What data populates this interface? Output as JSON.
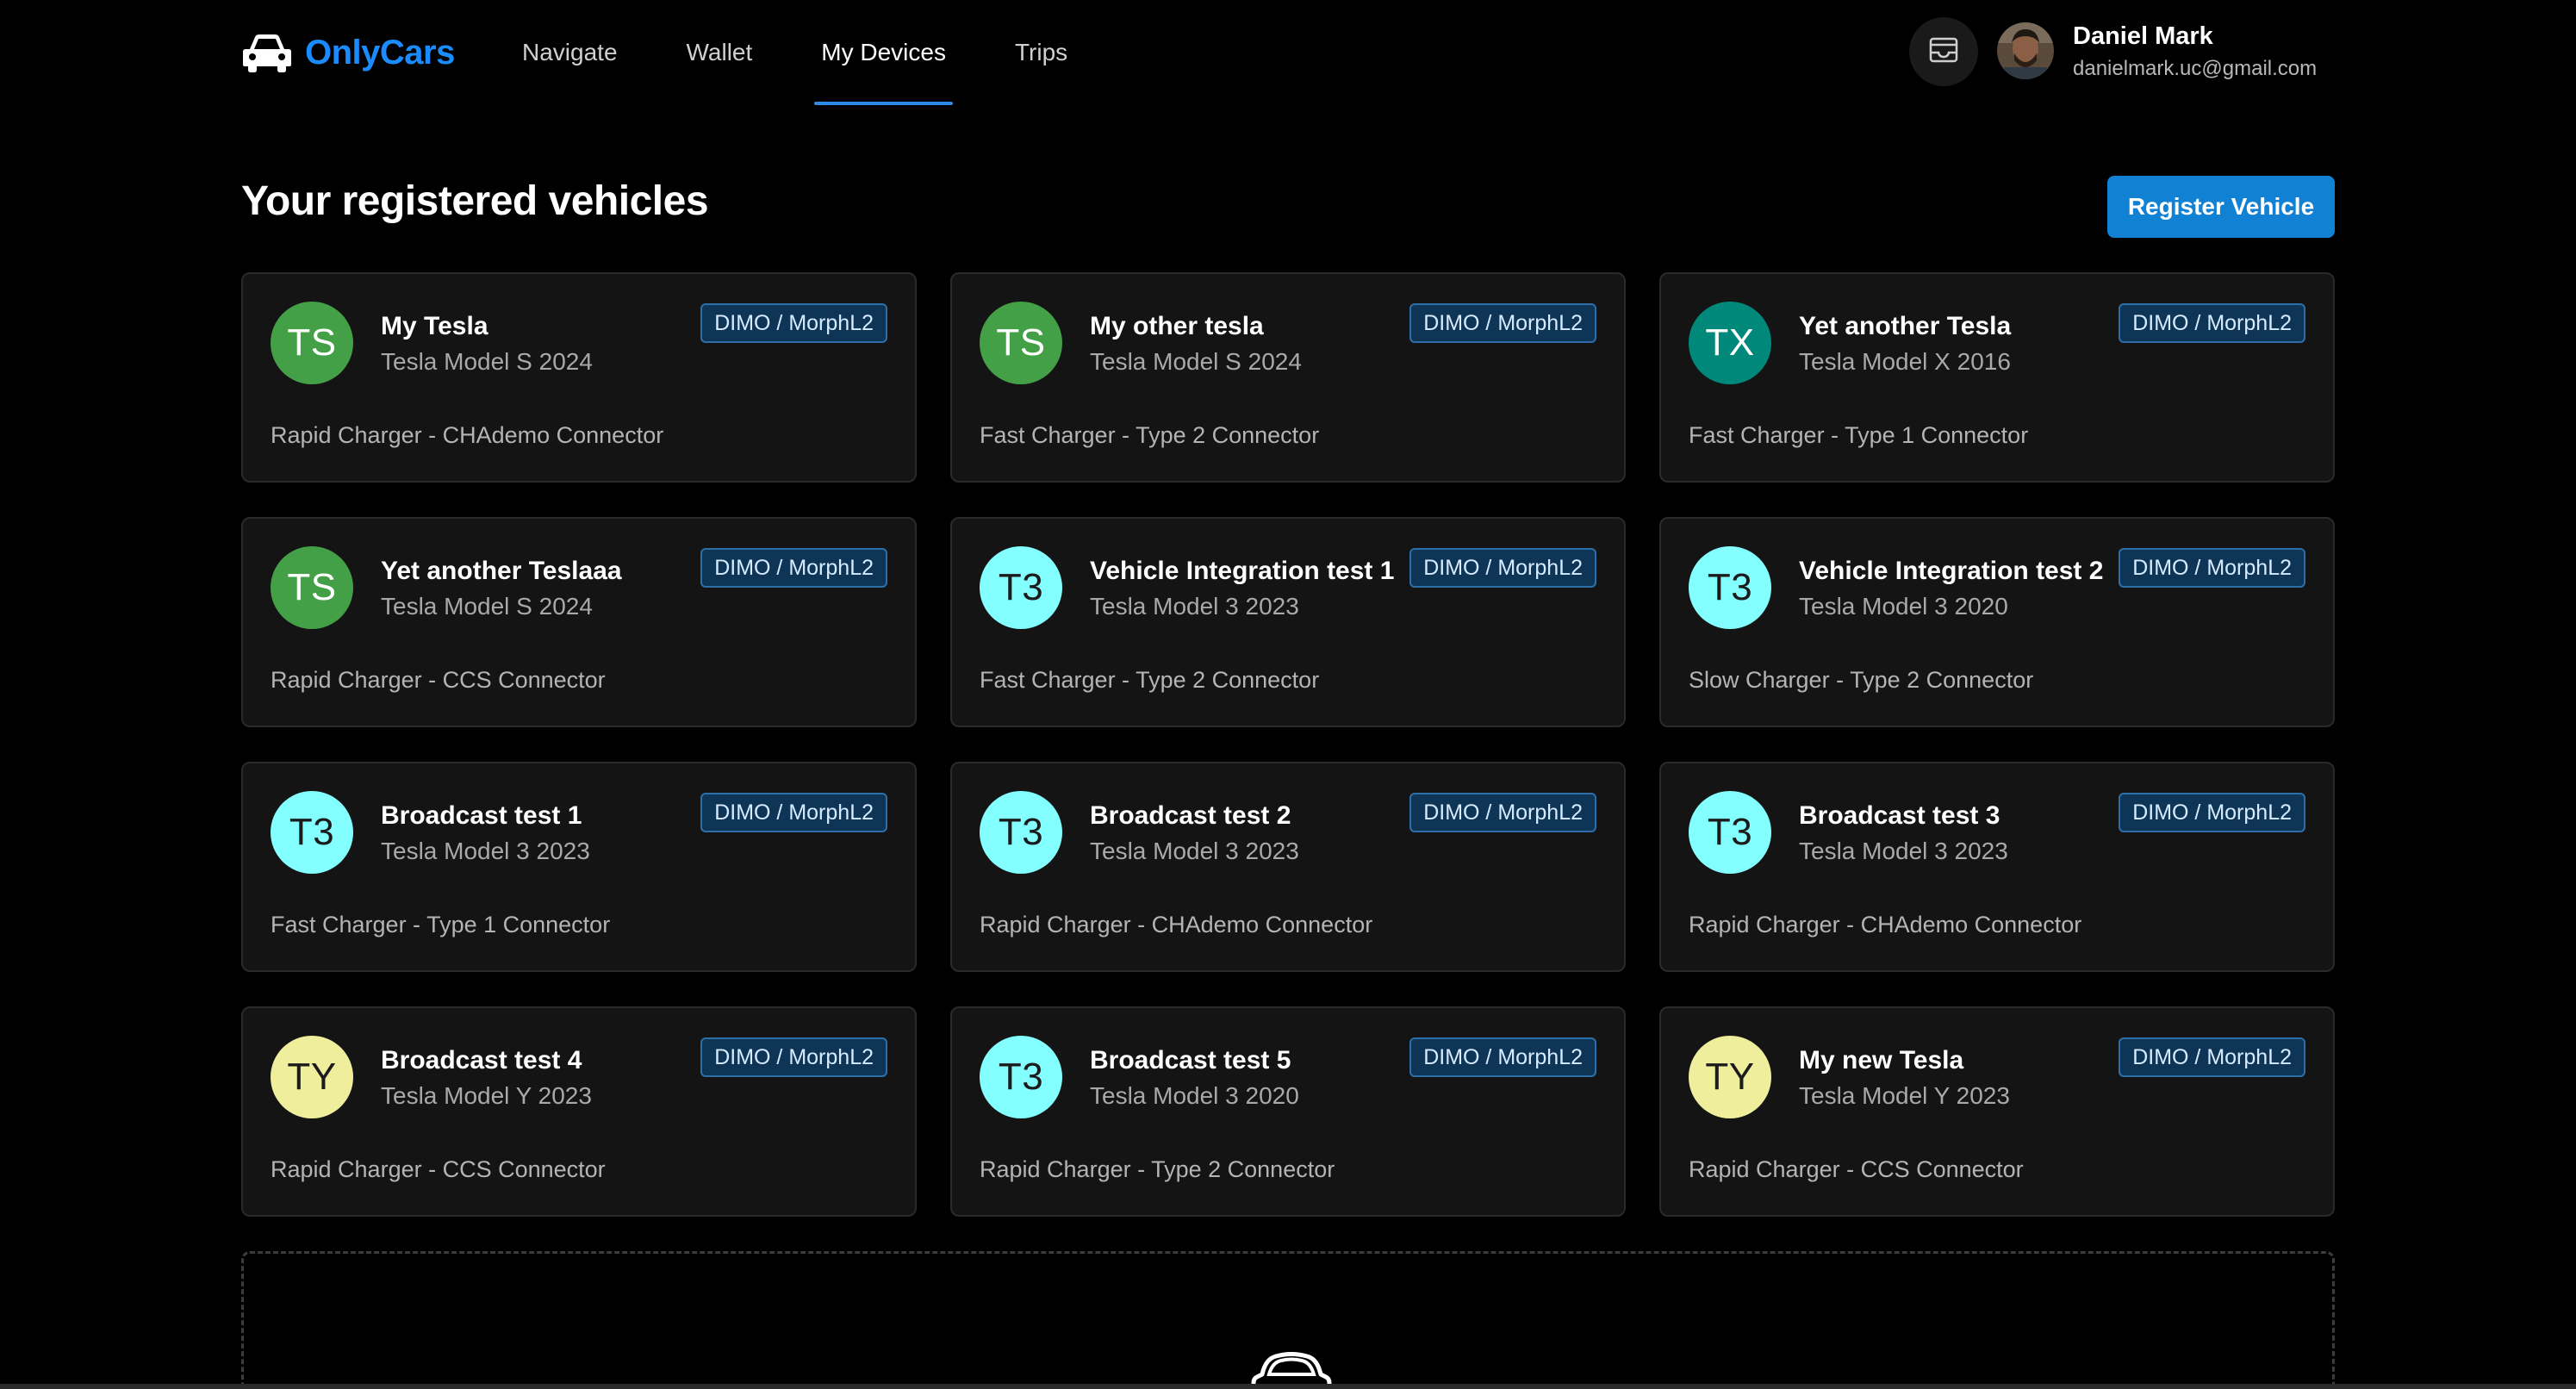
{
  "brand": {
    "name": "OnlyCars",
    "logo_icon": "car-icon",
    "color": "#1a8cff"
  },
  "nav": {
    "items": [
      {
        "label": "Navigate",
        "active": false
      },
      {
        "label": "Wallet",
        "active": false
      },
      {
        "label": "My Devices",
        "active": true
      },
      {
        "label": "Trips",
        "active": false
      }
    ],
    "accent_color": "#2b8be6"
  },
  "header": {
    "inbox_icon": "inbox-icon",
    "user": {
      "name": "Daniel Mark",
      "email": "danielmark.uc@gmail.com"
    }
  },
  "main": {
    "title": "Your registered vehicles",
    "register_button": "Register Vehicle",
    "register_button_color": "#1181d4",
    "vehicles": [
      {
        "initials": "TS",
        "avatar_color": "#43a047",
        "name": "My Tesla",
        "model": "Tesla Model S 2024",
        "badge": "DIMO / MorphL2",
        "charger": "Rapid Charger - CHAdemo Connector"
      },
      {
        "initials": "TS",
        "avatar_color": "#43a047",
        "name": "My other tesla",
        "model": "Tesla Model S 2024",
        "badge": "DIMO / MorphL2",
        "charger": "Fast Charger - Type 2 Connector"
      },
      {
        "initials": "TX",
        "avatar_color": "#00897b",
        "name": "Yet another Tesla",
        "model": "Tesla Model X 2016",
        "badge": "DIMO / MorphL2",
        "charger": "Fast Charger - Type 1 Connector"
      },
      {
        "initials": "TS",
        "avatar_color": "#43a047",
        "name": "Yet another Teslaaa",
        "model": "Tesla Model S 2024",
        "badge": "DIMO / MorphL2",
        "charger": "Rapid Charger - CCS Connector"
      },
      {
        "initials": "T3",
        "avatar_color": "#84ffff",
        "name": "Vehicle Integration test 1",
        "model": "Tesla Model 3 2023",
        "badge": "DIMO / MorphL2",
        "charger": "Fast Charger - Type 2 Connector"
      },
      {
        "initials": "T3",
        "avatar_color": "#84ffff",
        "name": "Vehicle Integration test 2",
        "model": "Tesla Model 3 2020",
        "badge": "DIMO / MorphL2",
        "charger": "Slow Charger - Type 2 Connector"
      },
      {
        "initials": "T3",
        "avatar_color": "#84ffff",
        "name": "Broadcast test 1",
        "model": "Tesla Model 3 2023",
        "badge": "DIMO / MorphL2",
        "charger": "Fast Charger - Type 1 Connector"
      },
      {
        "initials": "T3",
        "avatar_color": "#84ffff",
        "name": "Broadcast test 2",
        "model": "Tesla Model 3 2023",
        "badge": "DIMO / MorphL2",
        "charger": "Rapid Charger - CHAdemo Connector"
      },
      {
        "initials": "T3",
        "avatar_color": "#84ffff",
        "name": "Broadcast test 3",
        "model": "Tesla Model 3 2023",
        "badge": "DIMO / MorphL2",
        "charger": "Rapid Charger - CHAdemo Connector"
      },
      {
        "initials": "TY",
        "avatar_color": "#eeee9c",
        "name": "Broadcast test 4",
        "model": "Tesla Model Y 2023",
        "badge": "DIMO / MorphL2",
        "charger": "Rapid Charger - CCS Connector"
      },
      {
        "initials": "T3",
        "avatar_color": "#84ffff",
        "name": "Broadcast test 5",
        "model": "Tesla Model 3 2020",
        "badge": "DIMO / MorphL2",
        "charger": "Rapid Charger - Type 2 Connector"
      },
      {
        "initials": "TY",
        "avatar_color": "#eeee9c",
        "name": "My new Tesla",
        "model": "Tesla Model Y 2023",
        "badge": "DIMO / MorphL2",
        "charger": "Rapid Charger - CCS Connector"
      }
    ],
    "add_area_icon": "car-icon"
  }
}
